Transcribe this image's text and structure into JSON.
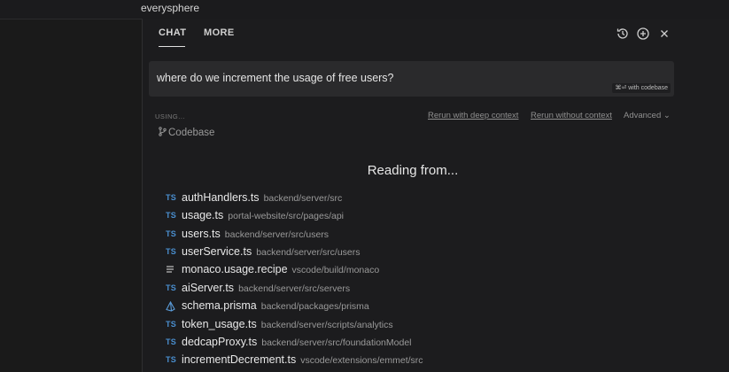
{
  "window": {
    "title": "everysphere"
  },
  "tabs": [
    {
      "label": "CHAT",
      "active": true
    },
    {
      "label": "MORE",
      "active": false
    }
  ],
  "header_icons": [
    "history-icon",
    "add-icon",
    "close-icon"
  ],
  "query": {
    "text": "where do we increment the usage of free users?",
    "shortcut_hint": "⌘⏎ with codebase"
  },
  "context": {
    "using_label": "USING...",
    "source": "Codebase",
    "rerun_deep": "Rerun with deep context",
    "rerun_without": "Rerun without context",
    "advanced": "Advanced ⌄"
  },
  "reading": {
    "title": "Reading from...",
    "files": [
      {
        "icon": "TS",
        "name": "authHandlers.ts",
        "path": "backend/server/src"
      },
      {
        "icon": "TS",
        "name": "usage.ts",
        "path": "portal-website/src/pages/api"
      },
      {
        "icon": "TS",
        "name": "users.ts",
        "path": "backend/server/src/users"
      },
      {
        "icon": "TS",
        "name": "userService.ts",
        "path": "backend/server/src/users"
      },
      {
        "icon": "lines-icon",
        "name": "monaco.usage.recipe",
        "path": "vscode/build/monaco"
      },
      {
        "icon": "TS",
        "name": "aiServer.ts",
        "path": "backend/server/src/servers"
      },
      {
        "icon": "prisma-icon",
        "name": "schema.prisma",
        "path": "backend/packages/prisma"
      },
      {
        "icon": "TS",
        "name": "token_usage.ts",
        "path": "backend/server/scripts/analytics"
      },
      {
        "icon": "TS",
        "name": "dedcapProxy.ts",
        "path": "backend/server/src/foundationModel"
      },
      {
        "icon": "TS",
        "name": "incrementDecrement.ts",
        "path": "vscode/extensions/emmet/src"
      }
    ]
  },
  "colors": {
    "ts_icon": "#4a8fd0",
    "background": "#1c1c1e",
    "query_box": "#2a2a2c"
  }
}
